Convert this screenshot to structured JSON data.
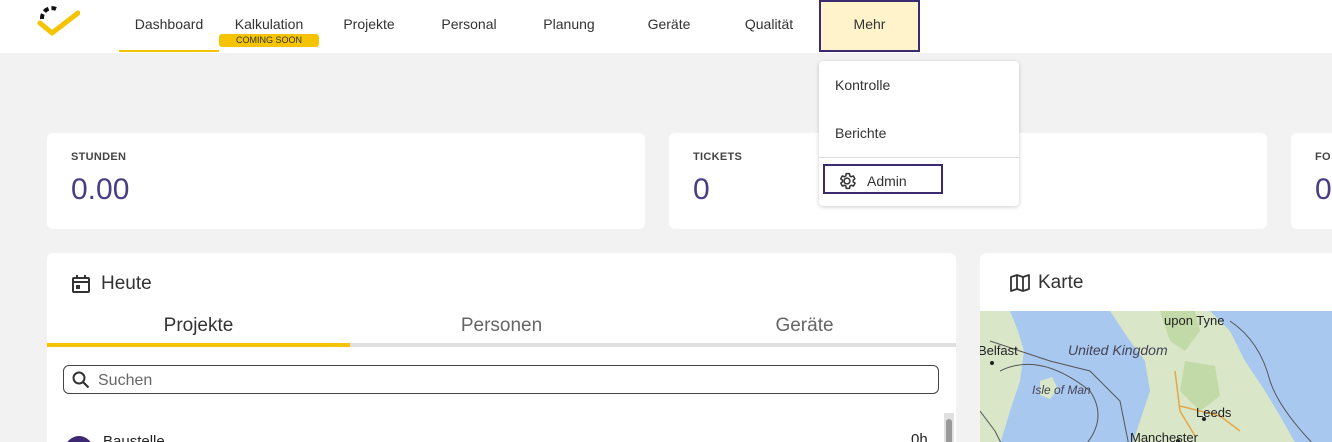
{
  "nav": {
    "items": [
      {
        "label": "Dashboard"
      },
      {
        "label": "Kalkulation",
        "badge": "COMING SOON"
      },
      {
        "label": "Projekte"
      },
      {
        "label": "Personal"
      },
      {
        "label": "Planung"
      },
      {
        "label": "Geräte"
      },
      {
        "label": "Qualität"
      },
      {
        "label": "Mehr"
      }
    ]
  },
  "dropdown": {
    "items": [
      "Kontrolle",
      "Berichte"
    ],
    "admin": "Admin"
  },
  "stats": [
    {
      "label": "STUNDEN",
      "value": "0.00"
    },
    {
      "label": "TICKETS",
      "value": "0"
    },
    {
      "label": "FO",
      "value": "0"
    }
  ],
  "today": {
    "title": "Heute",
    "tabs": [
      "Projekte",
      "Personen",
      "Geräte"
    ],
    "search_placeholder": "Suchen",
    "rows": [
      {
        "name": "Baustelle",
        "value": "0h"
      }
    ]
  },
  "map": {
    "title": "Karte",
    "labels": [
      "upon Tyne",
      "Belfast",
      "United Kingdom",
      "Isle of Man",
      "Leeds",
      "Manchester"
    ]
  },
  "colors": {
    "accent": "#f5c400",
    "primary": "#3b2a6f",
    "value": "#4a3d86"
  }
}
